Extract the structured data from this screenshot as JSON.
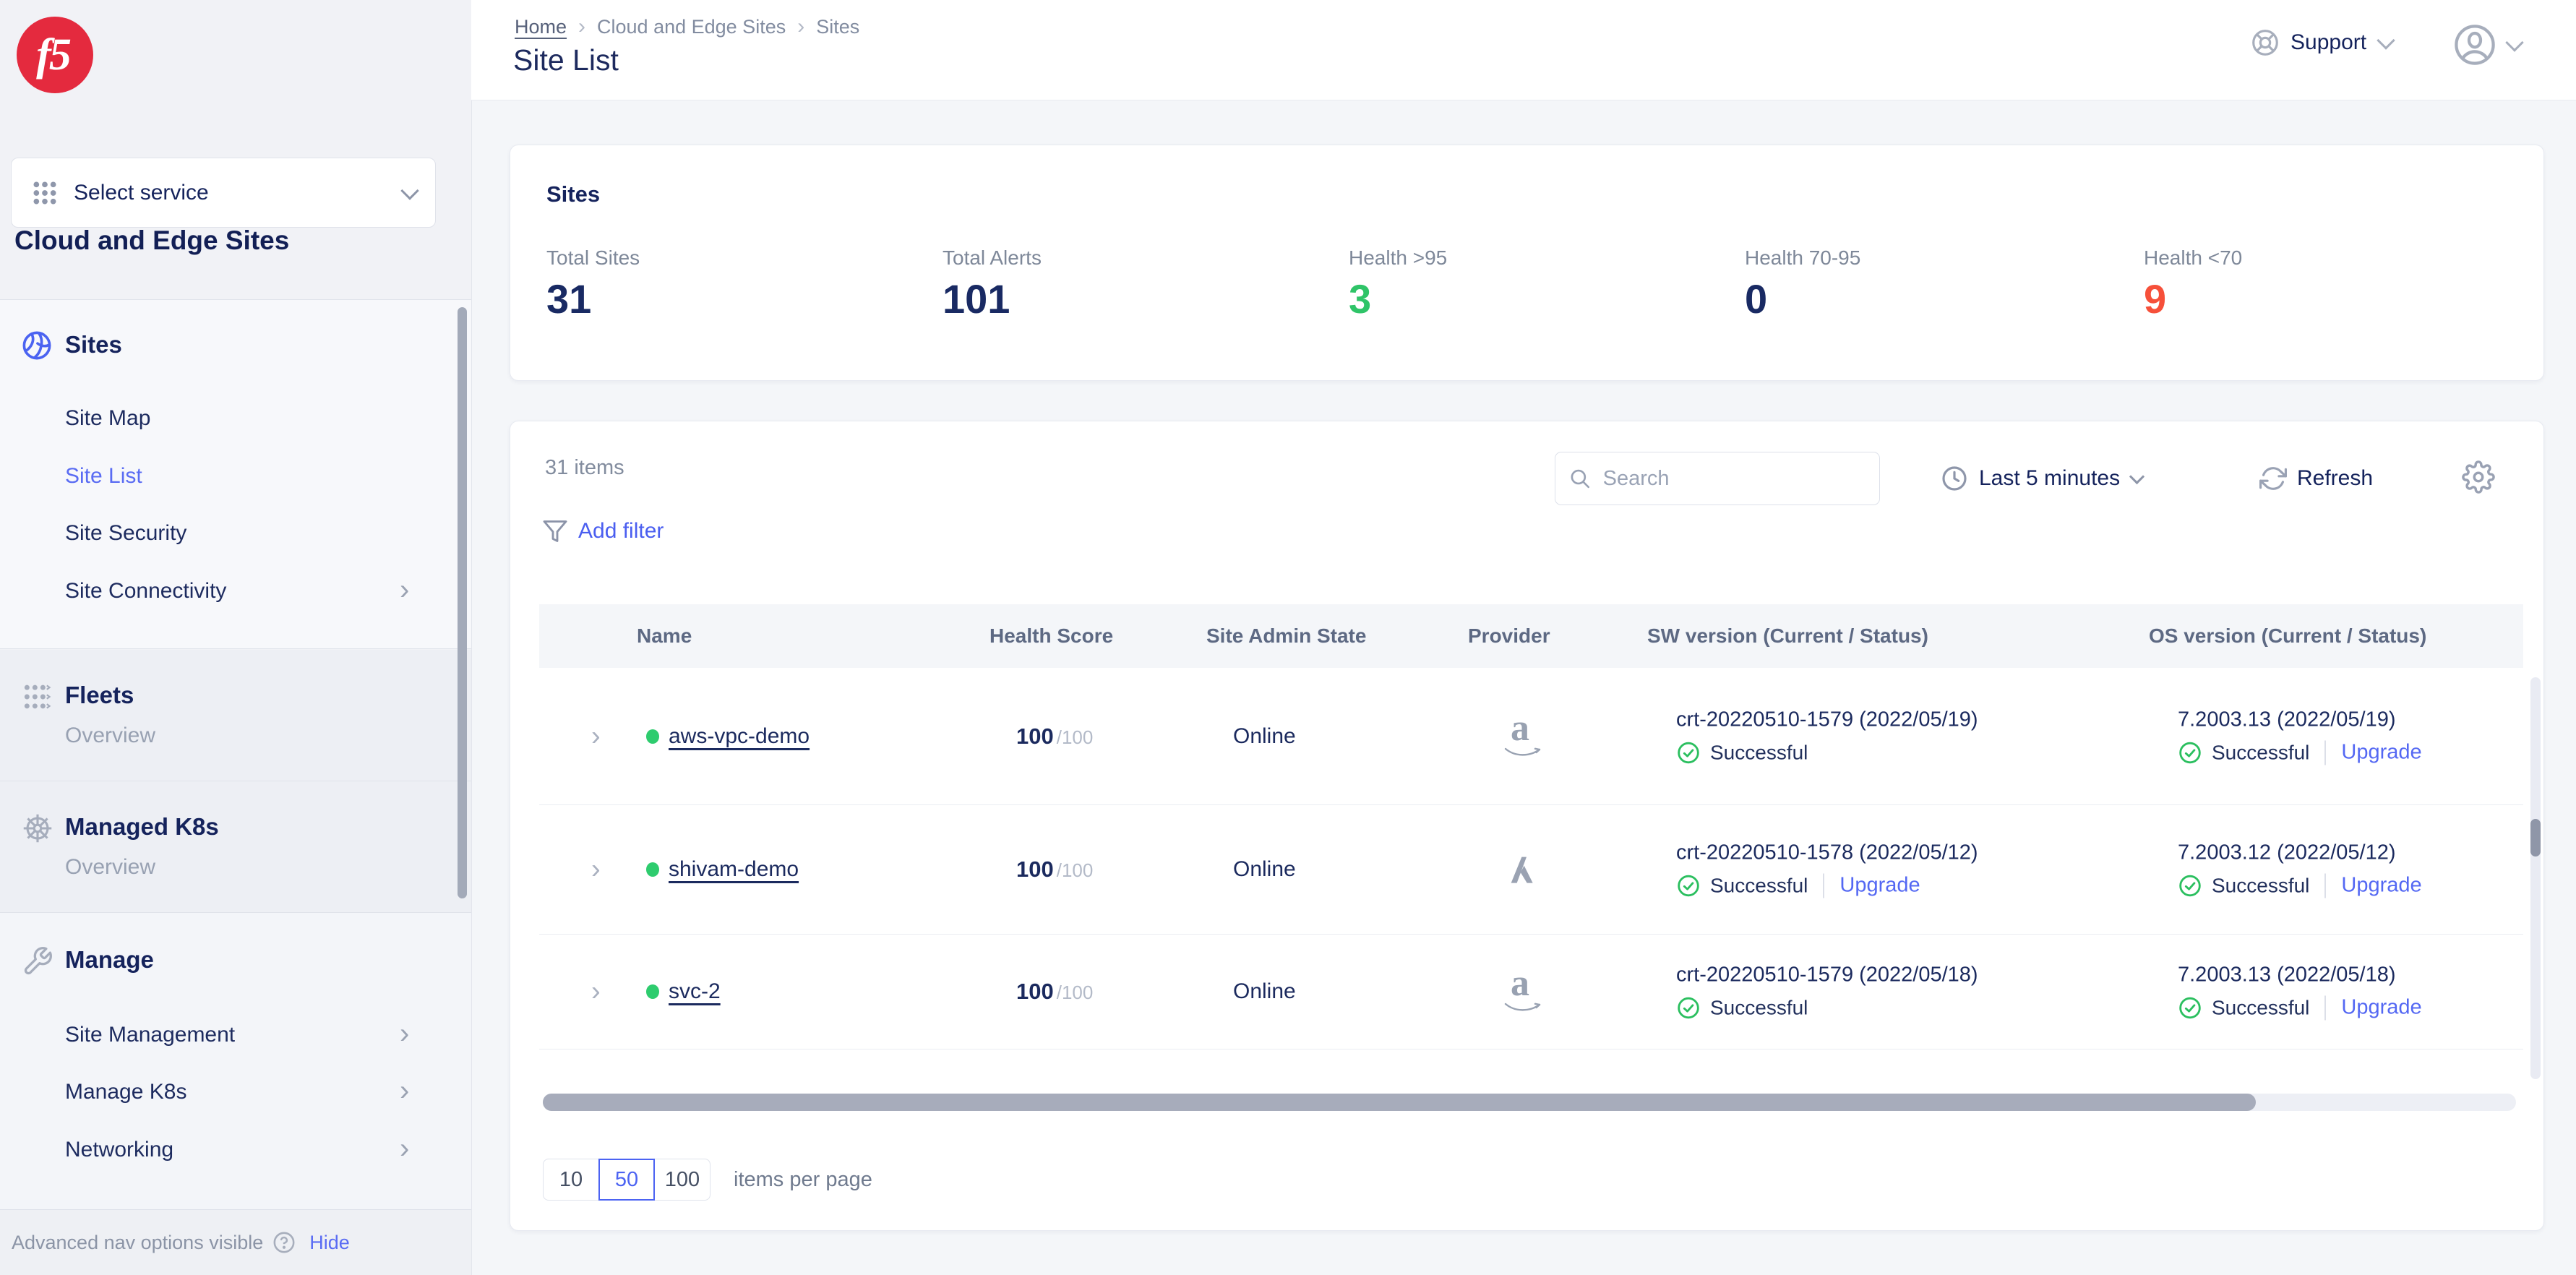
{
  "brand": {
    "logo_text": "f5",
    "logo_color": "#e42a3e"
  },
  "colors": {
    "navy": "#1b2a5e",
    "accent_blue": "#5468f3",
    "green": "#2fc468",
    "red": "#f6503a"
  },
  "sidebar": {
    "service_selector": {
      "label": "Select service"
    },
    "title": "Cloud and Edge Sites",
    "sections": [
      {
        "title": "Sites",
        "icon": "globe-icon",
        "items": [
          {
            "label": "Site Map"
          },
          {
            "label": "Site List",
            "active": true
          },
          {
            "label": "Site Security"
          },
          {
            "label": "Site Connectivity",
            "expandable": true
          }
        ]
      },
      {
        "title": "Fleets",
        "icon": "fleet-grid-icon",
        "items": [
          {
            "label": "Overview"
          }
        ]
      },
      {
        "title": "Managed K8s",
        "icon": "helm-wheel-icon",
        "items": [
          {
            "label": "Overview"
          }
        ]
      },
      {
        "title": "Manage",
        "icon": "wrench-icon",
        "items": [
          {
            "label": "Site Management",
            "expandable": true
          },
          {
            "label": "Manage K8s",
            "expandable": true
          },
          {
            "label": "Networking",
            "expandable": true
          }
        ]
      }
    ],
    "footer": {
      "text": "Advanced nav options visible",
      "action_label": "Hide"
    }
  },
  "topbar": {
    "breadcrumb": {
      "items": [
        "Home",
        "Cloud and Edge Sites",
        "Sites"
      ]
    },
    "page_title": "Site List",
    "support_label": "Support"
  },
  "stats": {
    "title": "Sites",
    "items": [
      {
        "label": "Total Sites",
        "value": "31",
        "color": "#192a63"
      },
      {
        "label": "Total Alerts",
        "value": "101",
        "color": "#192a63"
      },
      {
        "label": "Health >95",
        "value": "3",
        "color": "#2fc468"
      },
      {
        "label": "Health 70-95",
        "value": "0",
        "color": "#192a63"
      },
      {
        "label": "Health <70",
        "value": "9",
        "color": "#f6503a"
      }
    ]
  },
  "toolbar": {
    "items_count": "31 items",
    "search_placeholder": "Search",
    "time_range": "Last 5 minutes",
    "refresh_label": "Refresh",
    "add_filter_label": "Add filter"
  },
  "table": {
    "columns": [
      "Name",
      "Health Score",
      "Site Admin State",
      "Provider",
      "SW version (Current / Status)",
      "OS version (Current / Status)"
    ],
    "rows": [
      {
        "name": "aws-vpc-demo",
        "health": "100",
        "health_suffix": "/100",
        "admin_state": "Online",
        "provider": "aws",
        "sw": {
          "version": "crt-20220510-1579 (2022/05/19)",
          "status": "Successful"
        },
        "os": {
          "version": "7.2003.13 (2022/05/19)",
          "status": "Successful",
          "upgrade": "Upgrade"
        }
      },
      {
        "name": "shivam-demo",
        "health": "100",
        "health_suffix": "/100",
        "admin_state": "Online",
        "provider": "azure",
        "sw": {
          "version": "crt-20220510-1578 (2022/05/12)",
          "status": "Successful",
          "upgrade": "Upgrade"
        },
        "os": {
          "version": "7.2003.12 (2022/05/12)",
          "status": "Successful",
          "upgrade": "Upgrade"
        }
      },
      {
        "name": "svc-2",
        "health": "100",
        "health_suffix": "/100",
        "admin_state": "Online",
        "provider": "aws",
        "sw": {
          "version": "crt-20220510-1579 (2022/05/18)",
          "status": "Successful"
        },
        "os": {
          "version": "7.2003.13 (2022/05/18)",
          "status": "Successful",
          "upgrade": "Upgrade"
        }
      }
    ]
  },
  "pagination": {
    "options": [
      "10",
      "50",
      "100"
    ],
    "selected": "50",
    "label": "items per page"
  }
}
